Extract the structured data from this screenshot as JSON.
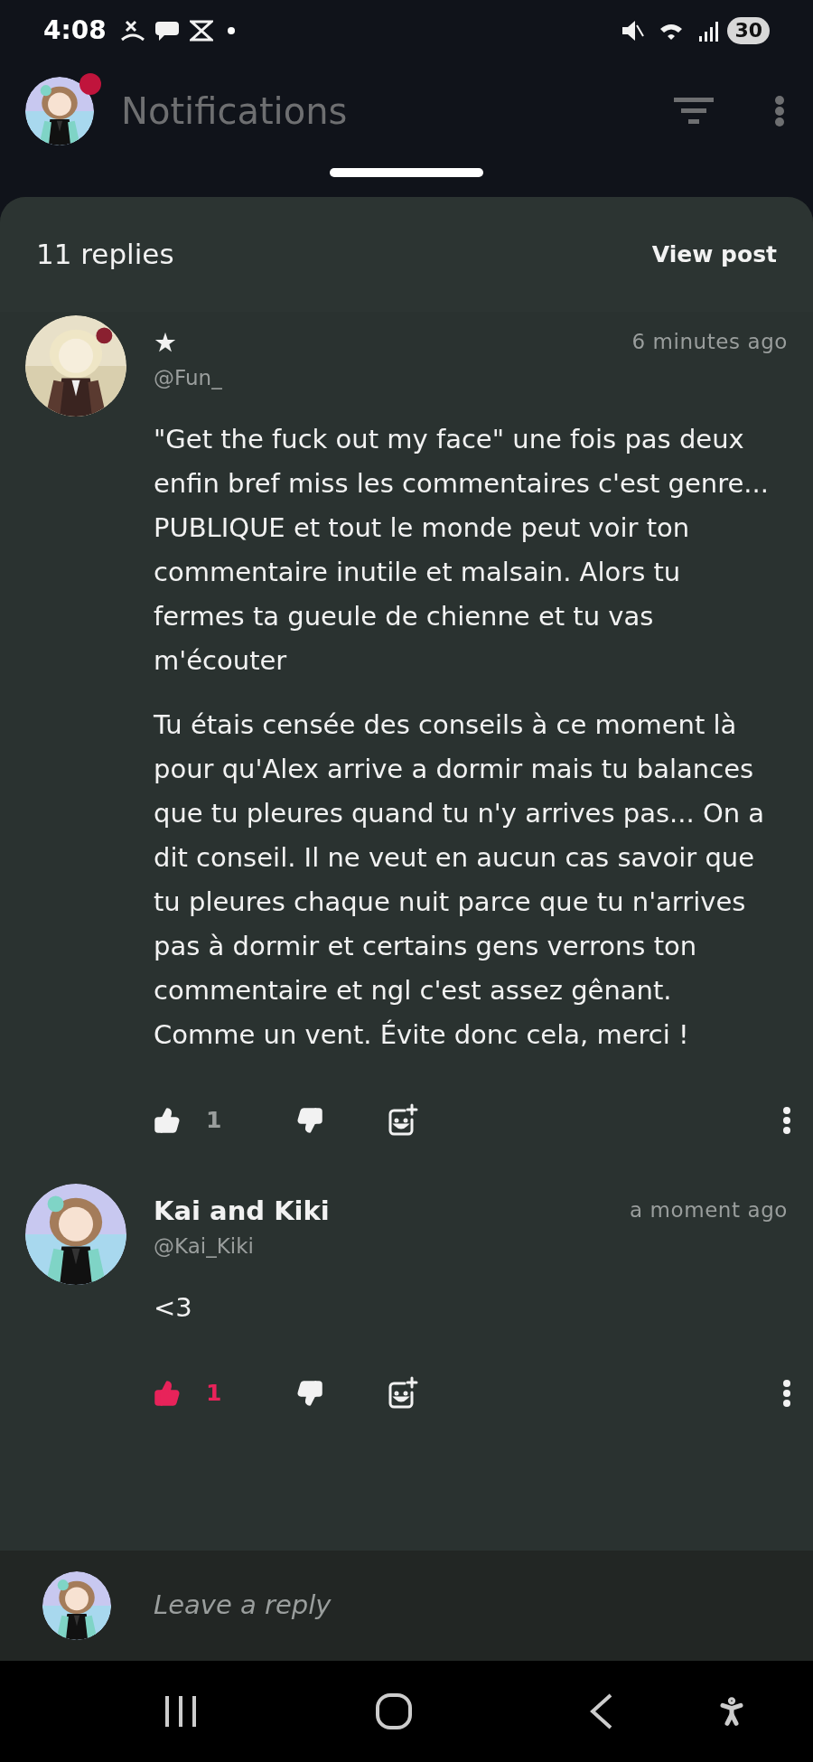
{
  "status_bar": {
    "time": "4:08",
    "battery": "30"
  },
  "header": {
    "title": "Notifications",
    "unread": true
  },
  "sheet": {
    "count": "11 replies",
    "view_post": "View post"
  },
  "comments": [
    {
      "name": "★",
      "handle": "@Fun_",
      "time": "6 minutes ago",
      "paragraphs": [
        "\"Get the fuck out my face\" une fois pas deux enfin bref miss les commentaires c'est genre... PUBLIQUE et tout le monde peut voir ton commentaire inutile et malsain. Alors tu fermes ta gueule de chienne et tu vas m'écouter",
        "Tu étais censée des conseils à ce moment là pour qu'Alex arrive a dormir mais tu balances que tu pleures quand tu n'y arrives pas... On a dit conseil. Il ne veut en aucun cas savoir que tu pleures chaque nuit parce que tu n'arrives pas à dormir et certains gens verrons ton commentaire et ngl c'est assez gênant. Comme un vent. Évite donc cela, merci !"
      ],
      "liked": false,
      "likes": "1"
    },
    {
      "name": "Kai and Kiki",
      "handle": "@Kai_Kiki",
      "time": "a moment ago",
      "paragraphs": [
        "<3"
      ],
      "liked": true,
      "likes": "1"
    }
  ],
  "reply": {
    "placeholder": "Leave a reply"
  }
}
